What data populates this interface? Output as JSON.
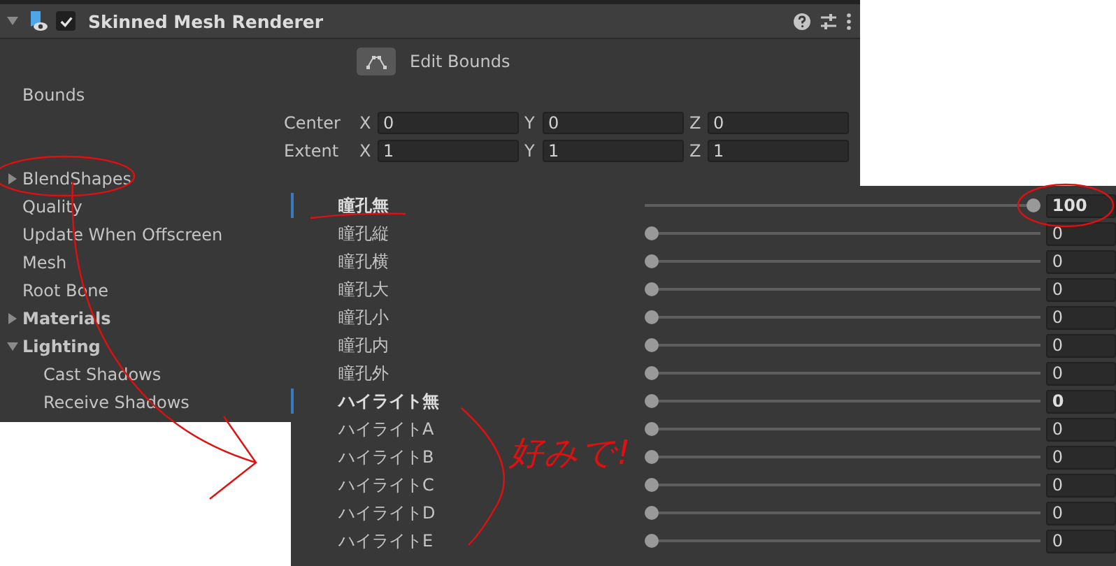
{
  "component": {
    "title": "Skinned Mesh Renderer",
    "enabled": true,
    "expanded": true
  },
  "edit_bounds": {
    "label": "Edit Bounds"
  },
  "bounds": {
    "label": "Bounds",
    "rows": [
      {
        "label": "Center",
        "fields": [
          {
            "axis": "X",
            "value": "0"
          },
          {
            "axis": "Y",
            "value": "0"
          },
          {
            "axis": "Z",
            "value": "0"
          }
        ]
      },
      {
        "label": "Extent",
        "fields": [
          {
            "axis": "X",
            "value": "1"
          },
          {
            "axis": "Y",
            "value": "1"
          },
          {
            "axis": "Z",
            "value": "1"
          }
        ]
      }
    ]
  },
  "properties": [
    {
      "label": "BlendShapes",
      "kind": "foldout",
      "expanded": false
    },
    {
      "label": "Quality",
      "kind": "field"
    },
    {
      "label": "Update When Offscreen",
      "kind": "field"
    },
    {
      "label": "Mesh",
      "kind": "field"
    },
    {
      "label": "Root Bone",
      "kind": "field"
    },
    {
      "label": "Materials",
      "kind": "section",
      "expanded": false
    },
    {
      "label": "Lighting",
      "kind": "section",
      "expanded": true,
      "children": [
        {
          "label": "Cast Shadows"
        },
        {
          "label": "Receive Shadows"
        }
      ]
    }
  ],
  "blend_shapes": [
    {
      "name": "瞳孔無",
      "value": "100",
      "level": 1,
      "overridden": true
    },
    {
      "name": "瞳孔縦",
      "value": "0",
      "level": 0,
      "overridden": false
    },
    {
      "name": "瞳孔横",
      "value": "0",
      "level": 0,
      "overridden": false
    },
    {
      "name": "瞳孔大",
      "value": "0",
      "level": 0,
      "overridden": false
    },
    {
      "name": "瞳孔小",
      "value": "0",
      "level": 0,
      "overridden": false
    },
    {
      "name": "瞳孔内",
      "value": "0",
      "level": 0,
      "overridden": false
    },
    {
      "name": "瞳孔外",
      "value": "0",
      "level": 0,
      "overridden": false
    },
    {
      "name": "ハイライト無",
      "value": "0",
      "level": 0,
      "overridden": true
    },
    {
      "name": "ハイライトA",
      "value": "0",
      "level": 0,
      "overridden": false
    },
    {
      "name": "ハイライトB",
      "value": "0",
      "level": 0,
      "overridden": false
    },
    {
      "name": "ハイライトC",
      "value": "0",
      "level": 0,
      "overridden": false
    },
    {
      "name": "ハイライトD",
      "value": "0",
      "level": 0,
      "overridden": false
    },
    {
      "name": "ハイライトE",
      "value": "0",
      "level": 0,
      "overridden": false
    }
  ],
  "annotation": {
    "note": "好みで!"
  }
}
